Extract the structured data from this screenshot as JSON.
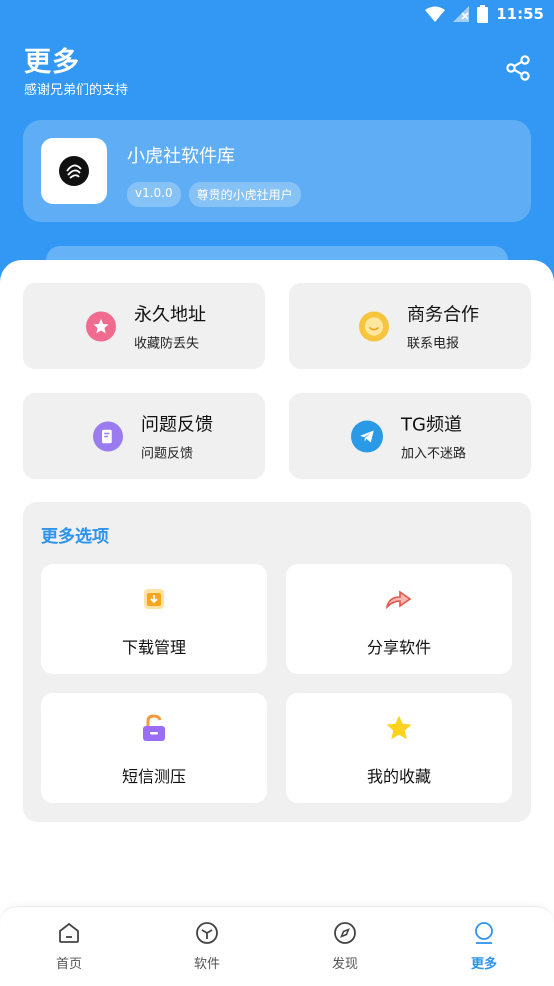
{
  "status": {
    "time": "11:55"
  },
  "header": {
    "title": "更多",
    "subtitle": "感谢兄弟们的支持"
  },
  "app": {
    "name": "小虎社软件库",
    "version": "v1.0.0",
    "user_badge": "尊贵的小虎社用户"
  },
  "tiles": [
    {
      "title": "永久地址",
      "sub": "收藏防丢失",
      "icon": "star-icon",
      "color": "#ef6b8f"
    },
    {
      "title": "商务合作",
      "sub": "联系电报",
      "icon": "smile-icon",
      "color": "#f7c43d"
    },
    {
      "title": "问题反馈",
      "sub": "问题反馈",
      "icon": "feedback-icon",
      "color": "#9b7cf0"
    },
    {
      "title": "TG频道",
      "sub": "加入不迷路",
      "icon": "telegram-icon",
      "color": "#2b9ae6"
    }
  ],
  "more": {
    "title": "更多选项",
    "options": [
      {
        "label": "下载管理",
        "icon": "download-icon"
      },
      {
        "label": "分享软件",
        "icon": "share-arrow-icon"
      },
      {
        "label": "短信测压",
        "icon": "unlock-icon"
      },
      {
        "label": "我的收藏",
        "icon": "star-icon"
      }
    ]
  },
  "nav": [
    {
      "label": "首页",
      "icon": "home-icon"
    },
    {
      "label": "软件",
      "icon": "cube-icon"
    },
    {
      "label": "发现",
      "icon": "compass-icon"
    },
    {
      "label": "更多",
      "icon": "more-icon",
      "active": true
    }
  ],
  "colors": {
    "primary": "#3298f3",
    "accent": "#2e93ee"
  }
}
